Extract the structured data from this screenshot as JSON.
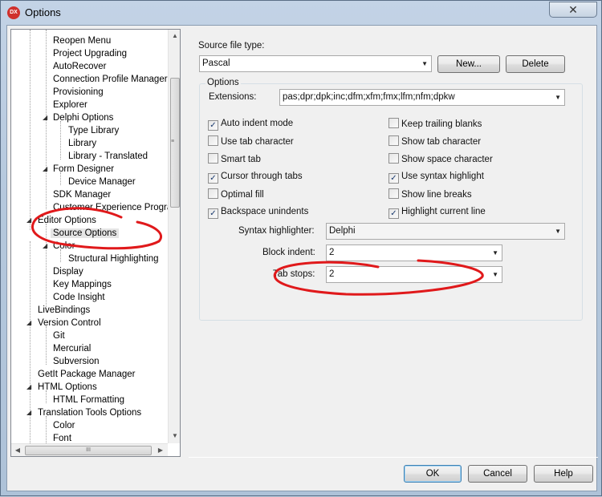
{
  "window": {
    "title": "Options",
    "app_icon": "DX",
    "close_symbol": "✕"
  },
  "tree": {
    "items": [
      {
        "label": "Reopen Menu"
      },
      {
        "label": "Project Upgrading"
      },
      {
        "label": "AutoRecover"
      },
      {
        "label": "Connection Profile Manager"
      },
      {
        "label": "Provisioning"
      },
      {
        "label": "Explorer"
      },
      {
        "label": "Delphi Options",
        "expanded": true
      },
      {
        "label": "Type Library"
      },
      {
        "label": "Library"
      },
      {
        "label": "Library - Translated"
      },
      {
        "label": "Form Designer",
        "expanded": true
      },
      {
        "label": "Device Manager"
      },
      {
        "label": "SDK Manager"
      },
      {
        "label": "Customer Experience Program"
      },
      {
        "label": "Editor Options",
        "expanded": true
      },
      {
        "label": "Source Options",
        "selected": true
      },
      {
        "label": "Color",
        "expanded": true
      },
      {
        "label": "Structural Highlighting"
      },
      {
        "label": "Display"
      },
      {
        "label": "Key Mappings"
      },
      {
        "label": "Code Insight"
      },
      {
        "label": "LiveBindings"
      },
      {
        "label": "Version Control",
        "expanded": true
      },
      {
        "label": "Git"
      },
      {
        "label": "Mercurial"
      },
      {
        "label": "Subversion"
      },
      {
        "label": "GetIt Package Manager"
      },
      {
        "label": "HTML Options",
        "expanded": true
      },
      {
        "label": "HTML Formatting"
      },
      {
        "label": "Translation Tools Options",
        "expanded": true
      },
      {
        "label": "Color"
      },
      {
        "label": "Font"
      }
    ],
    "expander_symbol": "◢",
    "scroll_up": "▲",
    "scroll_down": "▼",
    "scroll_left": "◀",
    "scroll_right": "▶",
    "grip_v": "≡",
    "grip_h": "III"
  },
  "source": {
    "type_label": "Source file type:",
    "type_value": "Pascal",
    "new_button": "New...",
    "delete_button": "Delete"
  },
  "options": {
    "group_title": "Options",
    "extensions_label": "Extensions:",
    "extensions_value": "pas;dpr;dpk;inc;dfm;xfm;fmx;lfm;nfm;dpkw",
    "checkboxes_left": [
      {
        "label": "Auto indent mode",
        "checked": true
      },
      {
        "label": "Use tab character",
        "checked": false
      },
      {
        "label": "Smart tab",
        "checked": false
      },
      {
        "label": "Cursor through tabs",
        "checked": true
      },
      {
        "label": "Optimal fill",
        "checked": false
      },
      {
        "label": "Backspace unindents",
        "checked": true
      }
    ],
    "checkboxes_right": [
      {
        "label": "Keep trailing blanks",
        "checked": false
      },
      {
        "label": "Show tab character",
        "checked": false
      },
      {
        "label": "Show space character",
        "checked": false
      },
      {
        "label": "Use syntax highlight",
        "checked": true
      },
      {
        "label": "Show line breaks",
        "checked": false
      },
      {
        "label": "Highlight current line",
        "checked": true
      }
    ],
    "syntax_label": "Syntax highlighter:",
    "syntax_value": "Delphi",
    "block_indent_label": "Block indent:",
    "block_indent_value": "2",
    "tab_stops_label": "Tab stops:",
    "tab_stops_value": "2",
    "check_mark": "✓",
    "dropdown_symbol": "▼"
  },
  "footer": {
    "ok": "OK",
    "cancel": "Cancel",
    "help": "Help"
  },
  "annotation_color": "#e0191b"
}
